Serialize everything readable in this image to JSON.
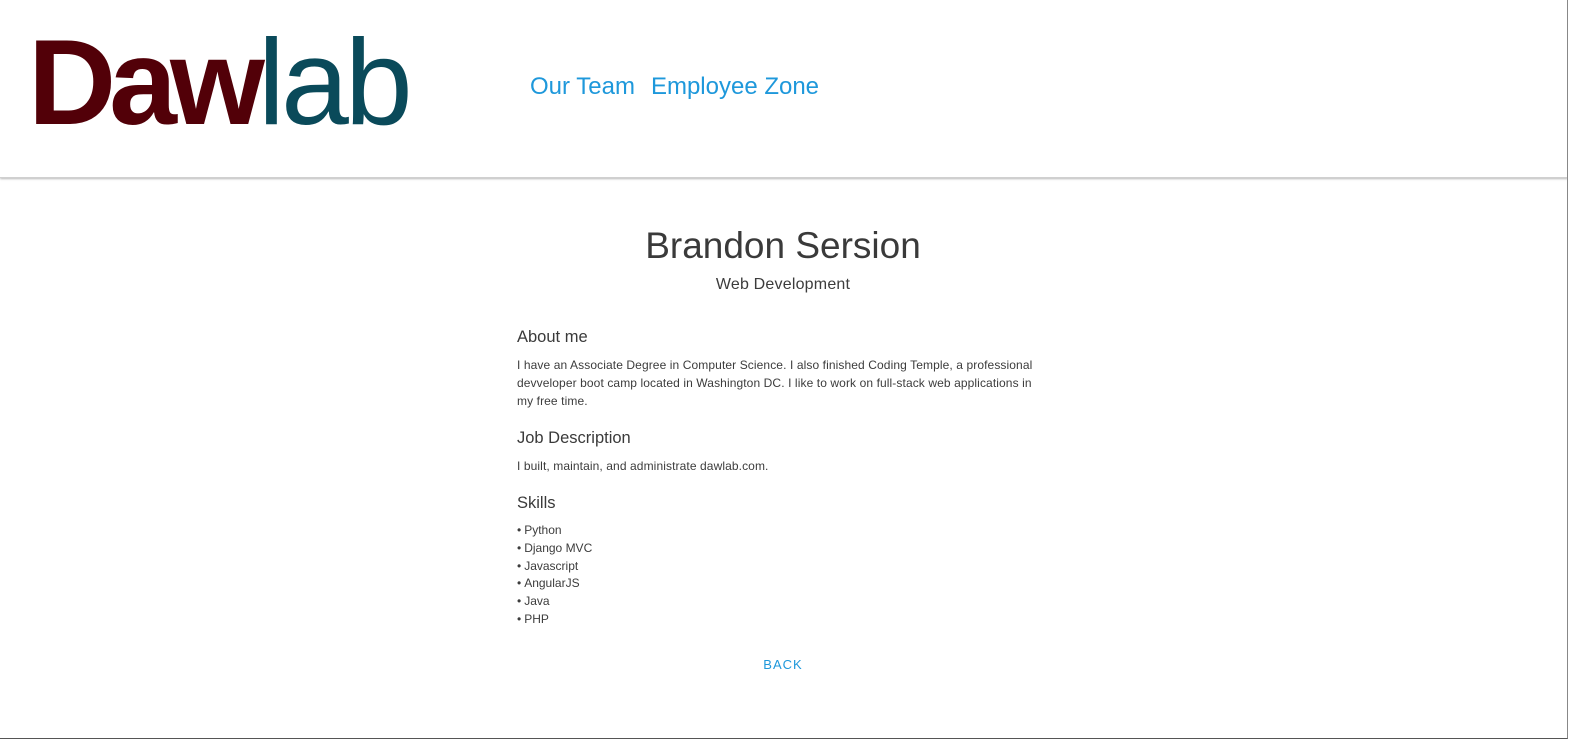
{
  "header": {
    "logo": {
      "part_a": "Daw",
      "part_b": "lab",
      "colors": {
        "part_a": "#520008",
        "part_b": "#0a4a5a"
      }
    },
    "nav": [
      {
        "label": "Our Team"
      },
      {
        "label": "Employee Zone"
      }
    ],
    "link_color": "#1e98db"
  },
  "profile": {
    "name": "Brandon Sersion",
    "department": "Web Development",
    "about": {
      "heading": "About me",
      "text": "I have an Associate Degree in Computer Science. I also finished Coding Temple, a professional devveloper boot camp located in Washington DC. I like to work on full-stack web applications in my free time."
    },
    "job": {
      "heading": "Job Description",
      "text": "I built, maintain, and administrate dawlab.com."
    },
    "skills": {
      "heading": "Skills",
      "items": [
        "Python",
        "Django MVC",
        "Javascript",
        "AngularJS",
        "Java",
        "PHP"
      ]
    },
    "back_label": "BACK"
  }
}
